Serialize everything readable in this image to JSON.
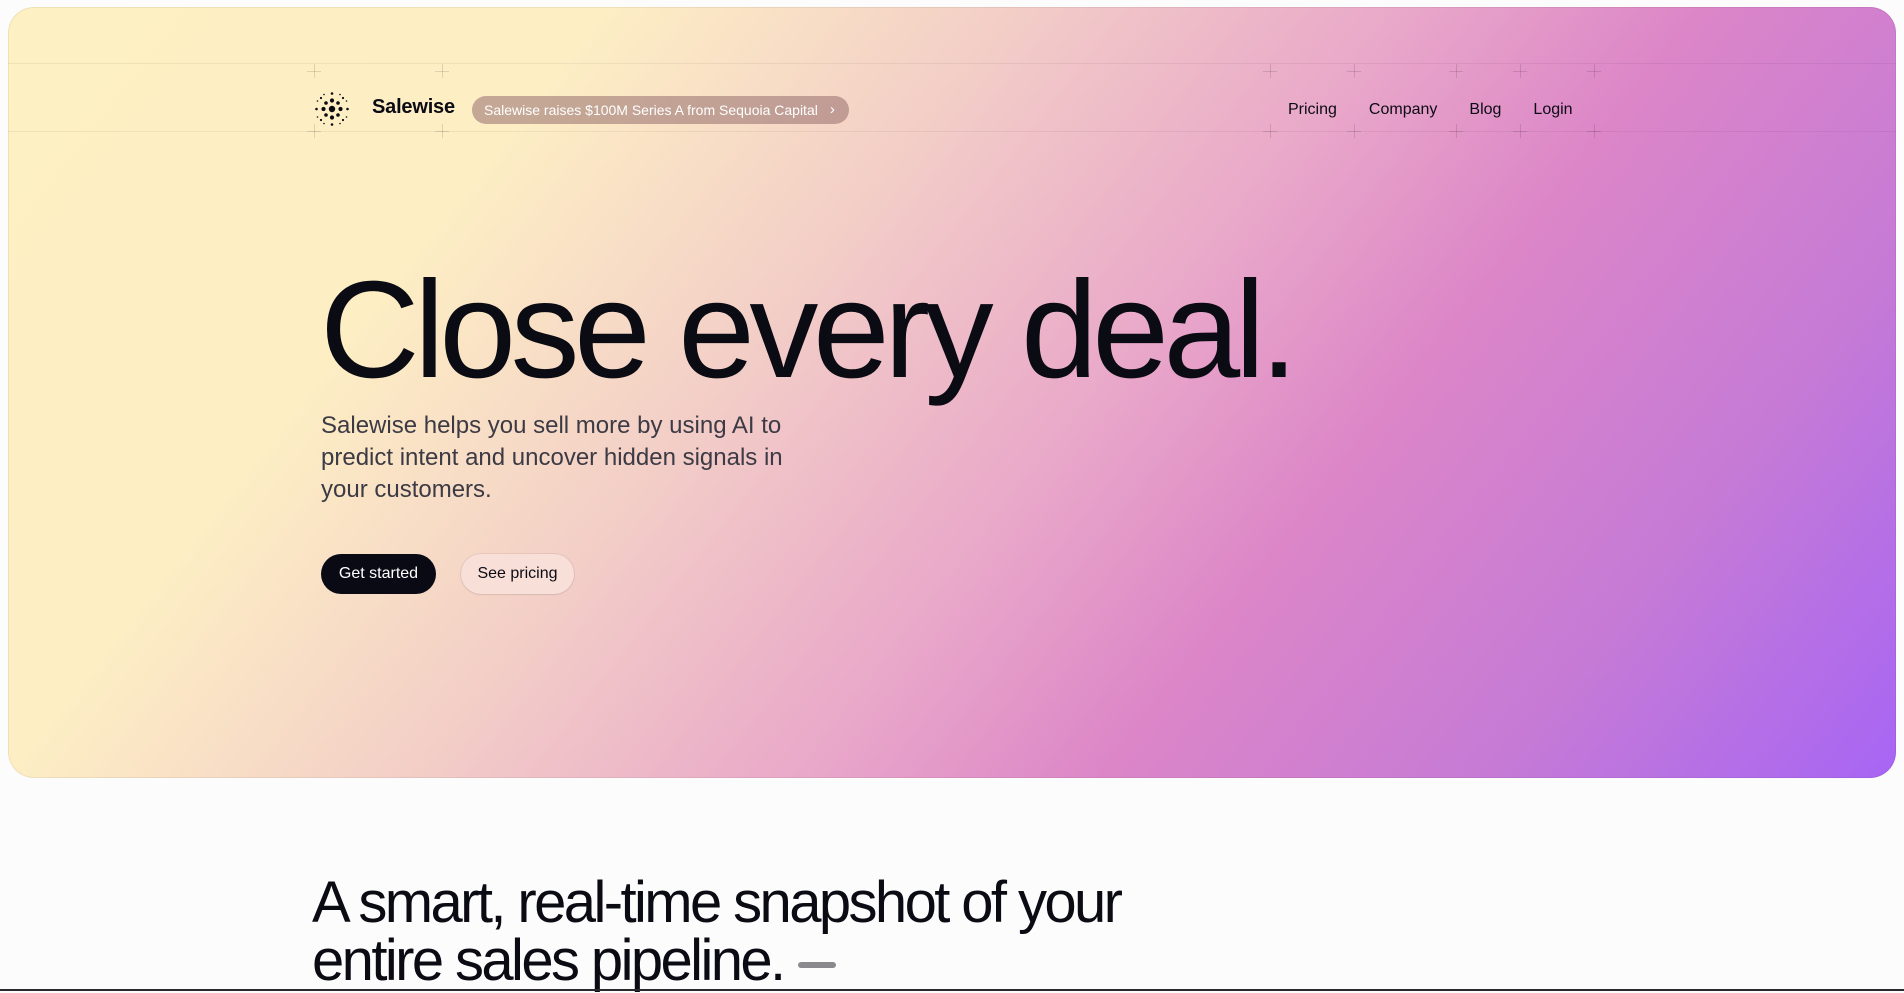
{
  "header": {
    "brand": "Salewise",
    "announcement": "Salewise raises $100M Series A from Sequoia Capital",
    "nav": [
      "Pricing",
      "Company",
      "Blog",
      "Login"
    ]
  },
  "hero": {
    "headline": "Close every deal.",
    "subtitle": "Salewise helps you sell more by using AI to predict intent and uncover hidden signals in your customers.",
    "primary_cta": "Get started",
    "secondary_cta": "See pricing"
  },
  "section": {
    "title": "A smart, real-time snapshot of your entire sales pipeline."
  },
  "icons": {
    "logo": "dotted-circle-logo-icon",
    "announcement_arrow": "chevron-right-icon"
  },
  "colors": {
    "text": "#0b0b14",
    "primary_button": "#0a0a14",
    "gradient_start": "#fdf0c2",
    "gradient_mid": "#dc86c8",
    "gradient_end": "#a765f4"
  }
}
